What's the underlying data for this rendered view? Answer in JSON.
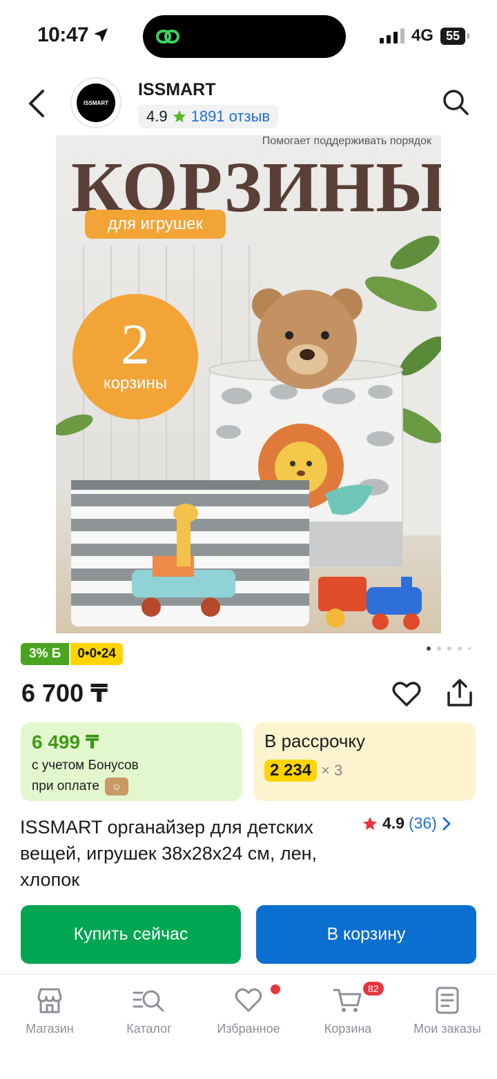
{
  "status": {
    "time": "10:47",
    "network": "4G",
    "battery": "55"
  },
  "header": {
    "seller": "ISSMART",
    "logo_text": "ISSMART",
    "rating": "4.9",
    "reviews": "1891 отзыв"
  },
  "image": {
    "subtitle": "Помогает поддерживать порядок",
    "title": "КОРЗИНЫ",
    "badge": "для игрушек",
    "circle_number": "2",
    "circle_word": "корзины"
  },
  "badges": {
    "cashback": "3% Б",
    "installment": "0•0•24"
  },
  "carousel": {
    "total": 5,
    "active_index": 0
  },
  "price": {
    "main": "6 700 ₸"
  },
  "bonus_card": {
    "price": "6 499 ₸",
    "line1": "с учетом Бонусов",
    "line2": "при оплате"
  },
  "installment_card": {
    "title": "В рассрочку",
    "amount": "2 234",
    "multiplier": "× 3"
  },
  "product": {
    "title": "ISSMART органайзер для детских вещей, игрушек 38х28х24 см, лен, хлопок",
    "rating": "4.9",
    "reviews_count": "(36)"
  },
  "actions": {
    "buy_now": "Купить сейчас",
    "add_to_cart": "В корзину"
  },
  "nav": {
    "items": [
      {
        "label": "Магазин",
        "icon": "shop-icon"
      },
      {
        "label": "Каталог",
        "icon": "catalog-icon"
      },
      {
        "label": "Избранное",
        "icon": "heart-icon"
      },
      {
        "label": "Корзина",
        "icon": "cart-icon",
        "badge": "82"
      },
      {
        "label": "Мои заказы",
        "icon": "orders-icon"
      }
    ]
  },
  "colors": {
    "green": "#00a651",
    "blue": "#0b6fd0",
    "yellow": "#ffd400",
    "red": "#e8343d"
  }
}
